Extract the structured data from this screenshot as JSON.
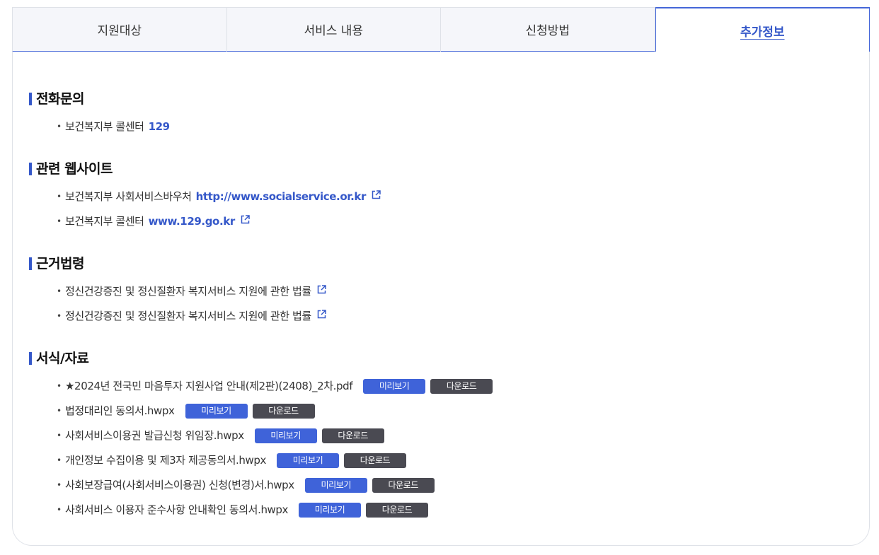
{
  "tabs": [
    {
      "label": "지원대상"
    },
    {
      "label": "서비스 내용"
    },
    {
      "label": "신청방법"
    },
    {
      "label": "추가정보"
    }
  ],
  "phone": {
    "title": "전화문의",
    "items": [
      {
        "text": "보건복지부 콜센터",
        "link": "129"
      }
    ]
  },
  "websites": {
    "title": "관련 웹사이트",
    "items": [
      {
        "text": "보건복지부 사회서비스바우처",
        "link": "http://www.socialservice.or.kr"
      },
      {
        "text": "보건복지부 콜센터",
        "link": "www.129.go.kr"
      }
    ]
  },
  "laws": {
    "title": "근거법령",
    "items": [
      {
        "text": "정신건강증진 및 정신질환자 복지서비스 지원에 관한 법률"
      },
      {
        "text": "정신건강증진 및 정신질환자 복지서비스 지원에 관한 법률"
      }
    ]
  },
  "forms": {
    "title": "서식/자료",
    "preview_label": "미리보기",
    "download_label": "다운로드",
    "items": [
      {
        "file": "★2024년 전국민 마음투자 지원사업 안내(제2판)(2408)_2차.pdf"
      },
      {
        "file": "법정대리인 동의서.hwpx"
      },
      {
        "file": "사회서비스이용권 발급신청 위임장.hwpx"
      },
      {
        "file": "개인정보 수집이용 및 제3자 제공동의서.hwpx"
      },
      {
        "file": "사회보장급여(사회서비스이용권) 신청(변경)서.hwpx"
      },
      {
        "file": "사회서비스 이용자 준수사항 안내확인 동의서.hwpx"
      }
    ]
  },
  "icons": {
    "bullet": "bullet-dot-icon",
    "external": "external-link-icon"
  },
  "colors": {
    "accent": "#3558c9",
    "preview_button": "#3f63d9",
    "download_button": "#4a4a52"
  }
}
